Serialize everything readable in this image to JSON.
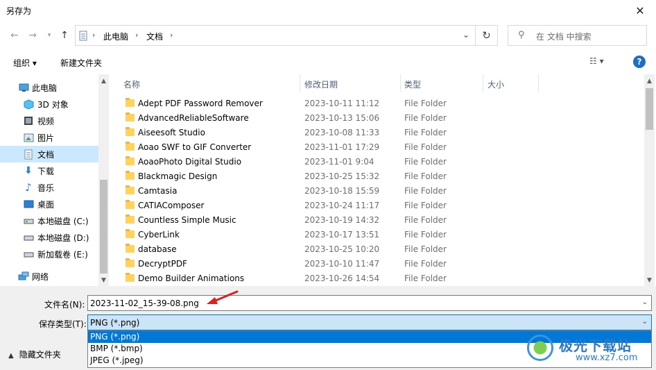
{
  "window": {
    "title": "另存为"
  },
  "address": {
    "segments": [
      "此电脑",
      "文档"
    ]
  },
  "search": {
    "placeholder": "在 文档 中搜索"
  },
  "toolbar": {
    "organize": "组织 ▾",
    "new_folder": "新建文件夹"
  },
  "nav": {
    "items": [
      {
        "label": "此电脑",
        "icon": "computer-icon"
      },
      {
        "label": "3D 对象",
        "icon": "cube-icon"
      },
      {
        "label": "视频",
        "icon": "video-icon"
      },
      {
        "label": "图片",
        "icon": "picture-icon"
      },
      {
        "label": "文档",
        "icon": "document-icon",
        "selected": true
      },
      {
        "label": "下载",
        "icon": "download-icon"
      },
      {
        "label": "音乐",
        "icon": "music-icon"
      },
      {
        "label": "桌面",
        "icon": "desktop-icon"
      },
      {
        "label": "本地磁盘 (C:)",
        "icon": "drive-icon"
      },
      {
        "label": "本地磁盘 (D:)",
        "icon": "drive-icon"
      },
      {
        "label": "新加载卷 (E:)",
        "icon": "drive-icon"
      },
      {
        "label": "网络",
        "icon": "network-icon"
      }
    ]
  },
  "columns": {
    "name": "名称",
    "date": "修改日期",
    "type": "类型",
    "size": "大小"
  },
  "files": [
    {
      "name": "Adept PDF Password Remover",
      "date": "2023-10-11 11:12",
      "type": "File Folder"
    },
    {
      "name": "AdvancedReliableSoftware",
      "date": "2023-10-13 15:06",
      "type": "File Folder"
    },
    {
      "name": "Aiseesoft Studio",
      "date": "2023-10-08 11:33",
      "type": "File Folder"
    },
    {
      "name": "Aoao SWF to GIF Converter",
      "date": "2023-11-01 17:29",
      "type": "File Folder"
    },
    {
      "name": "AoaoPhoto Digital Studio",
      "date": "2023-11-01 9:04",
      "type": "File Folder"
    },
    {
      "name": "Blackmagic Design",
      "date": "2023-10-25 15:32",
      "type": "File Folder"
    },
    {
      "name": "Camtasia",
      "date": "2023-10-18 15:59",
      "type": "File Folder"
    },
    {
      "name": "CATIAComposer",
      "date": "2023-10-24 11:17",
      "type": "File Folder"
    },
    {
      "name": "Countless Simple Music",
      "date": "2023-10-19 14:32",
      "type": "File Folder"
    },
    {
      "name": "CyberLink",
      "date": "2023-10-17 13:51",
      "type": "File Folder"
    },
    {
      "name": "database",
      "date": "2023-10-25 10:20",
      "type": "File Folder"
    },
    {
      "name": "DecryptPDF",
      "date": "2023-10-10 11:47",
      "type": "File Folder"
    },
    {
      "name": "Demo Builder Animations",
      "date": "2023-10-26 14:54",
      "type": "File Folder"
    }
  ],
  "form": {
    "filename_label": "文件名(N):",
    "filename_value": "2023-11-02_15-39-08.png",
    "filetype_label": "保存类型(T):",
    "filetype_value": "PNG (*.png)",
    "filetype_options": [
      "PNG (*.png)",
      "BMP (*.bmp)",
      "JPEG (*.jpeg)"
    ]
  },
  "hide_folders": "隐藏文件夹",
  "watermark": {
    "title": "极光下载站",
    "url": "www.xz7.com"
  },
  "colors": {
    "accent": "#0078d7",
    "selection": "#cce8ff",
    "folder": "#ffd35c",
    "arrow": "#e02020"
  }
}
